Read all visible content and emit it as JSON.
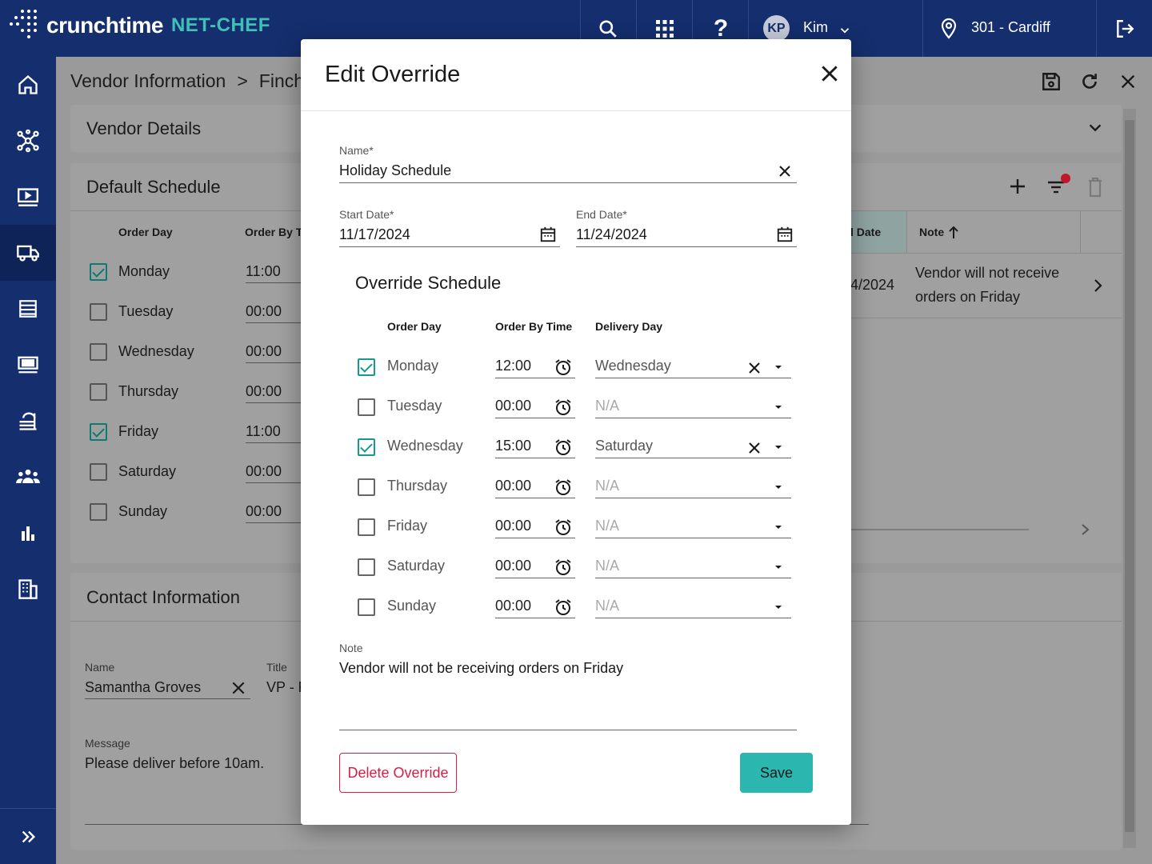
{
  "app": {
    "logo_text": "crunchtime",
    "logo_sub": "NET-CHEF",
    "user_initials": "KP",
    "user_name": "Kim",
    "location": "301 - Cardiff"
  },
  "breadcrumb": {
    "part1": "Vendor Information",
    "sep": ">",
    "part2": "Finch"
  },
  "vendor_details": {
    "title": "Vendor Details"
  },
  "default_schedule": {
    "title": "Default Schedule",
    "col_order_day": "Order Day",
    "col_order_by": "Order By T",
    "col_end_date": "l Date",
    "col_note": "Note",
    "rows": [
      {
        "day": "Monday",
        "time": "11:00",
        "checked": true
      },
      {
        "day": "Tuesday",
        "time": "00:00",
        "checked": false
      },
      {
        "day": "Wednesday",
        "time": "00:00",
        "checked": false
      },
      {
        "day": "Thursday",
        "time": "00:00",
        "checked": false
      },
      {
        "day": "Friday",
        "time": "11:00",
        "checked": true
      },
      {
        "day": "Saturday",
        "time": "00:00",
        "checked": false
      },
      {
        "day": "Sunday",
        "time": "00:00",
        "checked": false
      }
    ],
    "override_end": "4/2024",
    "override_note_line1": "Vendor will not receive",
    "override_note_line2": "orders on Friday"
  },
  "contact": {
    "title": "Contact Information",
    "name_label": "Name",
    "name_value": "Samantha Groves",
    "title_label": "Title",
    "title_value": "VP - F",
    "message_label": "Message",
    "message_value": "Please deliver before 10am."
  },
  "modal": {
    "title": "Edit Override",
    "name_label": "Name*",
    "name_value": "Holiday Schedule",
    "start_label": "Start Date*",
    "start_value": "11/17/2024",
    "end_label": "End Date*",
    "end_value": "11/24/2024",
    "schedule_title": "Override Schedule",
    "col_order_day": "Order Day",
    "col_order_by": "Order By Time",
    "col_delivery": "Delivery Day",
    "rows": [
      {
        "day": "Monday",
        "time": "12:00",
        "delivery": "Wednesday",
        "checked": true
      },
      {
        "day": "Tuesday",
        "time": "00:00",
        "delivery": "N/A",
        "checked": false
      },
      {
        "day": "Wednesday",
        "time": "15:00",
        "delivery": "Saturday",
        "checked": true
      },
      {
        "day": "Thursday",
        "time": "00:00",
        "delivery": "N/A",
        "checked": false
      },
      {
        "day": "Friday",
        "time": "00:00",
        "delivery": "N/A",
        "checked": false
      },
      {
        "day": "Saturday",
        "time": "00:00",
        "delivery": "N/A",
        "checked": false
      },
      {
        "day": "Sunday",
        "time": "00:00",
        "delivery": "N/A",
        "checked": false
      }
    ],
    "note_label": "Note",
    "note_value": "Vendor will not be receiving orders on Friday",
    "delete_label": "Delete Override",
    "save_label": "Save"
  },
  "colors": {
    "nav": "#142e6e",
    "accent": "#2bb7b0",
    "danger": "#d51f45",
    "check": "#159a90"
  }
}
